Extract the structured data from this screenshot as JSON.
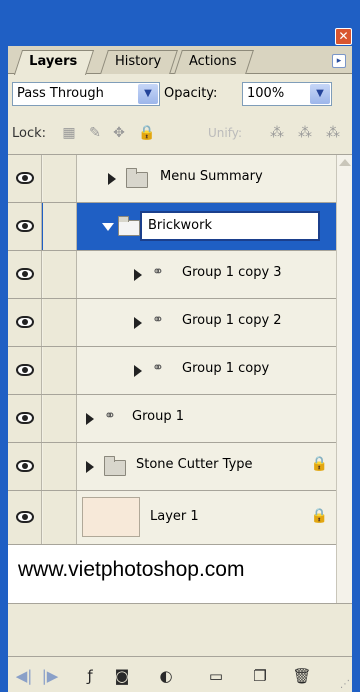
{
  "panel": {
    "close_glyph": "✕",
    "menu_glyph": "▸"
  },
  "tabs": [
    {
      "label": "Layers",
      "active": true
    },
    {
      "label": "History",
      "active": false
    },
    {
      "label": "Actions",
      "active": false
    }
  ],
  "blend": {
    "mode": "Pass Through",
    "opacity_label": "Opacity:",
    "opacity_value": "100%"
  },
  "lock": {
    "label": "Lock:",
    "unify_label": "Unify:"
  },
  "layers": [
    {
      "name": "Menu Summary",
      "type": "group",
      "expanded": false,
      "indent": 0
    },
    {
      "name": "Brickwork",
      "type": "group",
      "expanded": true,
      "indent": 0,
      "selected": true,
      "editing": true
    },
    {
      "name": "Group 1 copy 3",
      "type": "smart-group",
      "indent": 1
    },
    {
      "name": "Group 1 copy 2",
      "type": "smart-group",
      "indent": 1
    },
    {
      "name": "Group 1 copy",
      "type": "smart-group",
      "indent": 1
    },
    {
      "name": "Group 1",
      "type": "smart-group",
      "indent": 0
    },
    {
      "name": "Stone Cutter Type",
      "type": "group",
      "indent": 0,
      "locked": true
    },
    {
      "name": "Layer 1",
      "type": "layer",
      "indent": 0,
      "locked": true
    }
  ],
  "watermark": "www.vietphotoshop.com",
  "colors": {
    "accent": "#1f5fc4",
    "panel_bg": "#ece9d8"
  }
}
